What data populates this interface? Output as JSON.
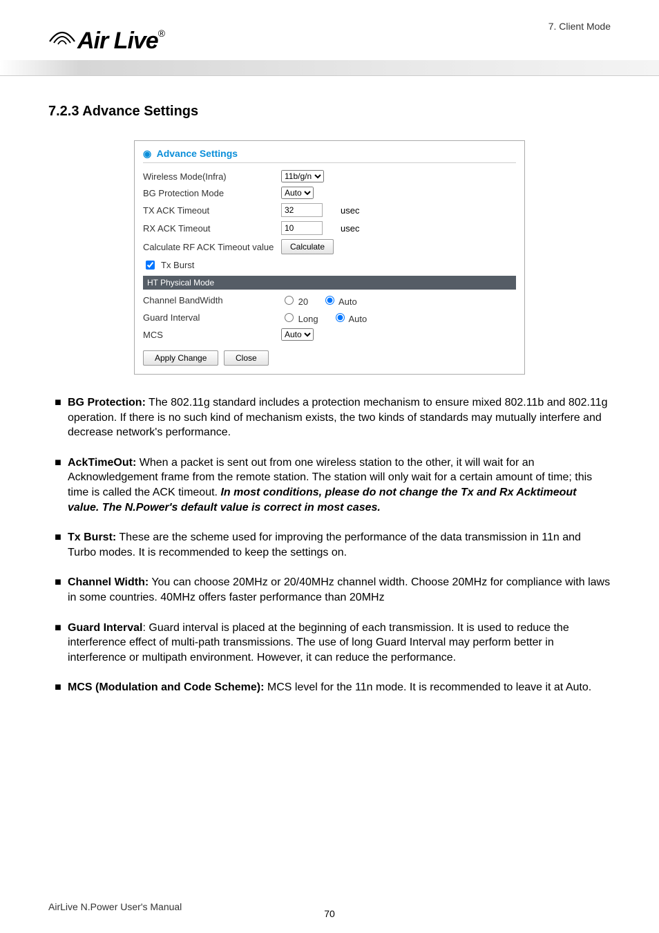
{
  "header": {
    "chapter": "7. Client Mode",
    "logo_text": "Air Live",
    "logo_reg": "®"
  },
  "section": {
    "heading": "7.2.3 Advance Settings"
  },
  "panel": {
    "title": "Advance Settings",
    "wireless_mode_label": "Wireless Mode(Infra)",
    "wireless_mode_value": "11b/g/n",
    "bg_protection_label": "BG Protection Mode",
    "bg_protection_value": "Auto",
    "tx_ack_label": "TX ACK Timeout",
    "tx_ack_value": "32",
    "rx_ack_label": "RX ACK Timeout",
    "rx_ack_value": "10",
    "usec_label": "usec",
    "calc_label": "Calculate RF ACK Timeout value",
    "calc_button": "Calculate",
    "tx_burst_label": "Tx Burst",
    "ht_header": "HT Physical Mode",
    "channel_bw_label": "Channel BandWidth",
    "channel_bw_opt1": "20",
    "channel_bw_opt2": "Auto",
    "guard_label": "Guard Interval",
    "guard_opt1": "Long",
    "guard_opt2": "Auto",
    "mcs_label": "MCS",
    "mcs_value": "Auto",
    "apply_button": "Apply Change",
    "close_button": "Close"
  },
  "bullets": {
    "bg_title": "BG Protection:",
    "bg_text": "   The 802.11g standard includes a protection mechanism to ensure mixed 802.11b and 802.11g operation. If there is no such kind of mechanism exists, the two kinds of standards may mutually interfere and decrease network's performance.",
    "ack_title": "AckTimeOut:",
    "ack_text": "   When a packet is sent out from one wireless station to the other, it will wait for an Acknowledgement frame from the remote station.    The station will only wait for a certain amount of time; this time is called the ACK timeout.    ",
    "ack_emph": "In most conditions, please do not change the Tx and Rx Acktimeout value.    The N.Power's default value is correct in most cases.",
    "txb_title": "Tx Burst:",
    "txb_text": "   These are the scheme used for improving the performance of the data transmission in 11n and Turbo modes.    It is recommended to keep the settings on.",
    "cw_title": "Channel Width:",
    "cw_text": "   You can choose 20MHz or 20/40MHz channel width.    Choose 20MHz for compliance with laws in some countries.    40MHz offers faster performance than 20MHz",
    "gi_title": "Guard Interval",
    "gi_text": ": Guard interval is placed at the beginning of each transmission.    It is used to reduce the interference effect of multi-path transmissions.    The use of long Guard Interval may perform better in interference or multipath environment.    However, it can reduce the performance.",
    "mcs_title": "MCS (Modulation and Code Scheme):",
    "mcs_text": " MCS level for the 11n mode.    It is recommended to leave it at Auto."
  },
  "footer": {
    "left": "AirLive N.Power User's Manual",
    "page": "70"
  }
}
